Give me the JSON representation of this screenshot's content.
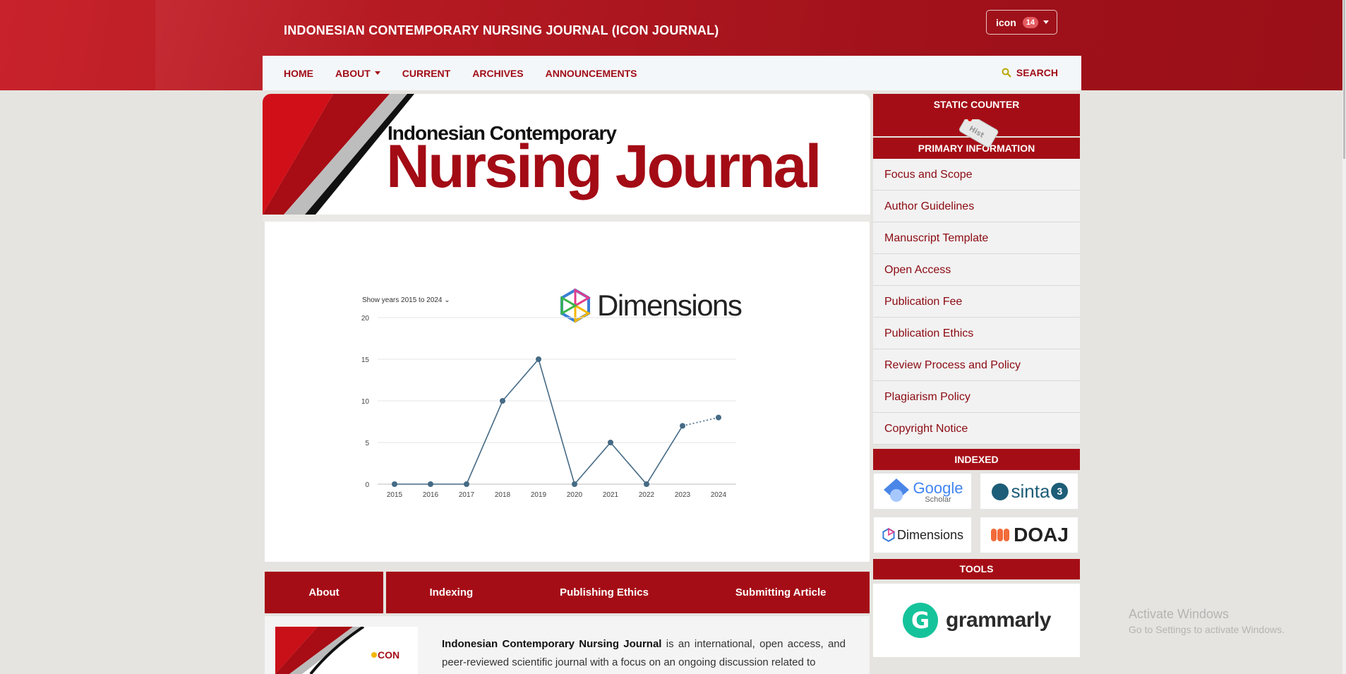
{
  "header": {
    "site_title": "INDONESIAN CONTEMPORARY NURSING JOURNAL (ICON JOURNAL)",
    "user_label": "icon",
    "user_badge": "14",
    "brand_color": "#a50d16"
  },
  "nav": {
    "items": [
      {
        "label": "HOME"
      },
      {
        "label": "ABOUT",
        "has_dropdown": true
      },
      {
        "label": "CURRENT"
      },
      {
        "label": "ARCHIVES"
      },
      {
        "label": "ANNOUNCEMENTS"
      }
    ],
    "search_label": "SEARCH"
  },
  "banner": {
    "subtitle": "Indonesian Contemporary",
    "title": "Nursing Journal"
  },
  "chart": {
    "select_label": "Show years 2015 to 2024",
    "brand_label": "Dimensions"
  },
  "chart_data": {
    "type": "line",
    "x": [
      "2015",
      "2016",
      "2017",
      "2018",
      "2019",
      "2020",
      "2021",
      "2022",
      "2023",
      "2024"
    ],
    "series": [
      {
        "values": [
          0,
          0,
          0,
          10,
          15,
          0,
          5,
          0,
          7,
          8
        ],
        "projected_from_index": 8
      }
    ],
    "yticks": [
      0,
      5,
      10,
      15,
      20
    ],
    "ylim": [
      0,
      20
    ],
    "grid": true,
    "color": "#456a85"
  },
  "tabs": {
    "items": [
      "About",
      "Indexing",
      "Publishing Ethics",
      "Submitting Article"
    ]
  },
  "about": {
    "journal_name": "Indonesian Contemporary Nursing Journal",
    "text": " is an international, open access, and peer-reviewed scientific journal with a focus on an ongoing discussion related to"
  },
  "sidebar": {
    "counter_title": "STATIC COUNTER",
    "primary_title": "PRIMARY INFORMATION",
    "links": [
      "Focus and Scope",
      "Author Guidelines",
      "Manuscript Template",
      "Open Access",
      "Publication Fee",
      "Publication Ethics",
      "Review Process and Policy",
      "Plagiarism Policy",
      "Copyright Notice"
    ],
    "indexed_title": "INDEXED",
    "indexes": {
      "google_main": "Google",
      "google_sub": "Scholar",
      "sinta": "sinta",
      "sinta_rank": "3",
      "dimensions": "Dimensions",
      "doaj": "DOAJ"
    },
    "tools_title": "TOOLS",
    "grammarly": "grammarly"
  },
  "watermark": {
    "line1": "Activate Windows",
    "line2": "Go to Settings to activate Windows."
  }
}
